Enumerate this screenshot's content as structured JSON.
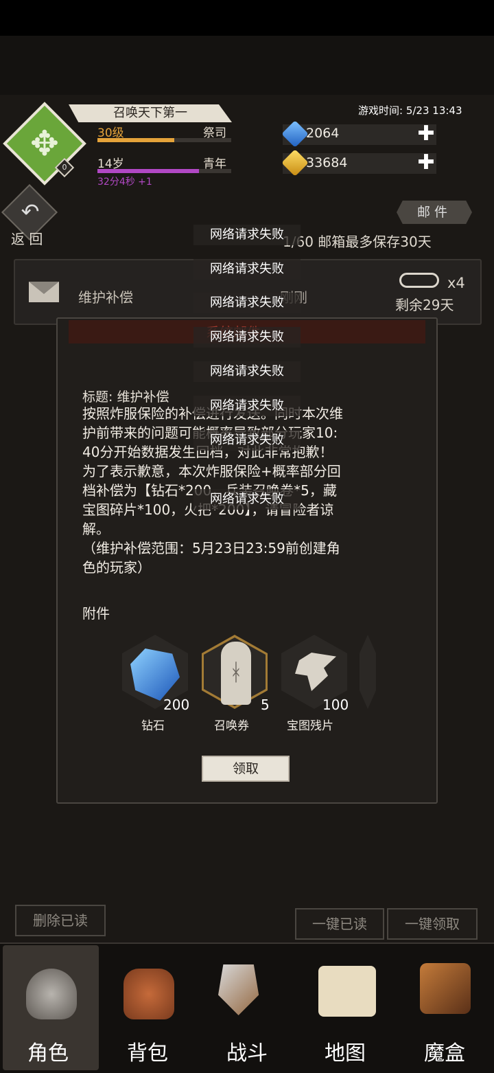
{
  "player": {
    "name": "召唤天下第一",
    "level": "30级",
    "class": "祭司",
    "age": "14岁",
    "stage": "青年",
    "timer": "32分4秒 +1",
    "badge": "0",
    "level_progress": 0.57,
    "age_progress": 0.76
  },
  "game_time": "游戏时间: 5/23 13:43",
  "currency": {
    "diamond": "2064",
    "gold": "33684",
    "plus": "✚"
  },
  "nav_back": "返 回",
  "mail_tab": "邮件",
  "mailbox_info": "1/60 邮箱最多保存30天",
  "mail_item": {
    "title": "维护补偿",
    "time": "刚刚",
    "attachments": "x4",
    "remaining": "剩余29天"
  },
  "modal": {
    "header": "系统邮件",
    "title": "标题: 维护补偿",
    "body": [
      "按照炸服保险的补偿进行发送。同时本次维",
      "护前带来的问题可能概率导致部分玩家10:",
      "40分开始数据发生回档，对此非常抱歉！",
      "为了表示歉意，本次炸服保险+概率部分回",
      "档补偿为【钻石*200，兵装召唤卷*5，藏",
      "宝图碎片*100，火把*200】，请冒险者谅",
      "解。",
      "（维护补偿范围：5月23日23:59前创建角",
      "色的玩家）"
    ],
    "attach_label": "附件",
    "items": [
      {
        "name": "钻石",
        "count": "200"
      },
      {
        "name": "召唤券",
        "count": "5"
      },
      {
        "name": "宝图残片",
        "count": "100"
      }
    ],
    "claim": "领取"
  },
  "toasts": [
    "网络请求失败",
    "网络请求失败",
    "网络请求失败",
    "网络请求失败",
    "网络请求失败",
    "网络请求失败",
    "网络请求失败",
    "网络请求失败"
  ],
  "buttons": {
    "delete_read": "删除已读",
    "read_all": "一键已读",
    "claim_all": "一键领取"
  },
  "nav": [
    "角色",
    "背包",
    "战斗",
    "地图",
    "魔盒"
  ],
  "colors": {
    "level": "#e5a33a",
    "age": "#b148c4",
    "accent_header": "#a1392f"
  }
}
